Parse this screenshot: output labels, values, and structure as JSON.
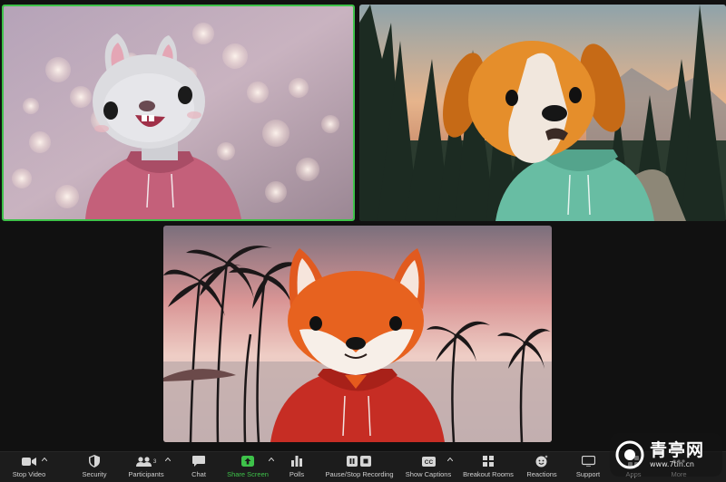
{
  "participants_count": "3",
  "toolbar": {
    "items": [
      {
        "label": "Stop Video",
        "icon": "video-camera-icon"
      },
      {
        "label": "Security",
        "icon": "shield-icon"
      },
      {
        "label": "Participants",
        "icon": "people-icon"
      },
      {
        "label": "Chat",
        "icon": "chat-bubble-icon"
      },
      {
        "label": "Share Screen",
        "icon": "share-screen-icon"
      },
      {
        "label": "Polls",
        "icon": "bar-chart-icon"
      },
      {
        "label": "Pause/Stop Recording",
        "icon": "pause-stop-icon"
      },
      {
        "label": "Show Captions",
        "icon": "cc-icon"
      },
      {
        "label": "Breakout Rooms",
        "icon": "grid-icon"
      },
      {
        "label": "Reactions",
        "icon": "emoji-plus-icon"
      },
      {
        "label": "Support",
        "icon": "support-icon"
      },
      {
        "label": "Apps",
        "icon": "apps-icon"
      },
      {
        "label": "More",
        "icon": "more-icon"
      }
    ]
  },
  "colors": {
    "active_speaker_border": "#3ec24a",
    "share_screen_green": "#3ec24a",
    "toolbar_bg": "#1c1c1c"
  },
  "watermark": {
    "text": "青亭网",
    "url": "www.7tin.cn"
  }
}
